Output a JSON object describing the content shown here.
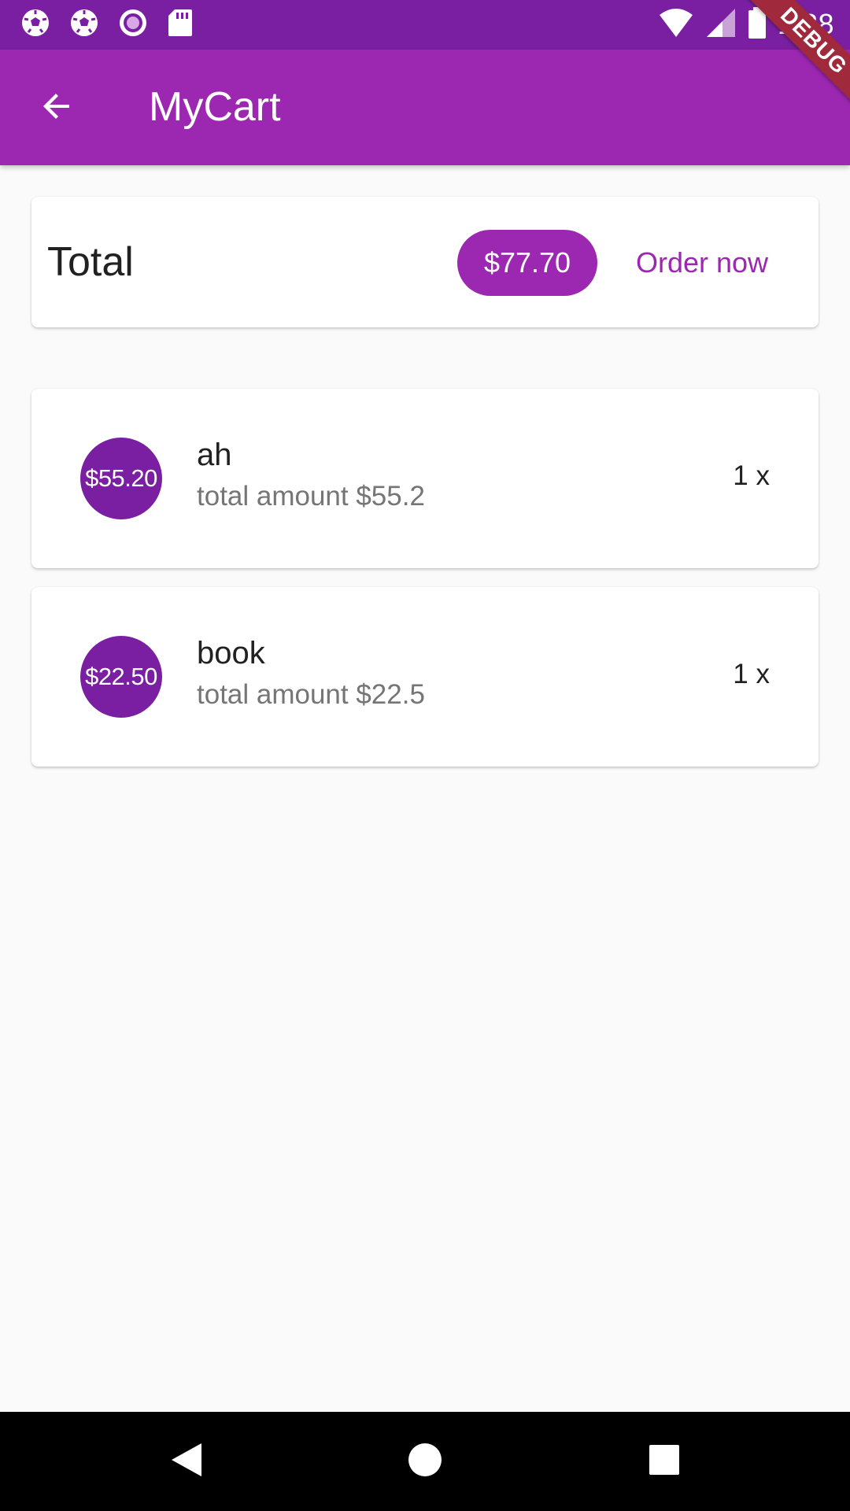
{
  "status_bar": {
    "time": "1:38",
    "left_icons": [
      "soccer-ball-icon",
      "soccer-ball-icon",
      "radio-button-icon",
      "sd-card-icon"
    ],
    "right_icons": [
      "wifi-icon",
      "cell-signal-icon",
      "battery-icon"
    ]
  },
  "debug_banner": "DEBUG",
  "app_bar": {
    "title": "MyCart",
    "back_icon": "arrow-back-icon"
  },
  "total_card": {
    "label": "Total",
    "amount": "$77.70",
    "action": "Order now"
  },
  "items": [
    {
      "price": "$55.20",
      "title": "ah",
      "subtitle": "total amount $55.2",
      "quantity": "1 x"
    },
    {
      "price": "$22.50",
      "title": "book",
      "subtitle": "total amount $22.5",
      "quantity": "1 x"
    }
  ],
  "nav_bar": {
    "icons": [
      "nav-back-icon",
      "nav-home-icon",
      "nav-recents-icon"
    ]
  },
  "colors": {
    "primary": "#9c27b0",
    "primary_dark": "#7b1fa2",
    "background": "#fafafa"
  }
}
